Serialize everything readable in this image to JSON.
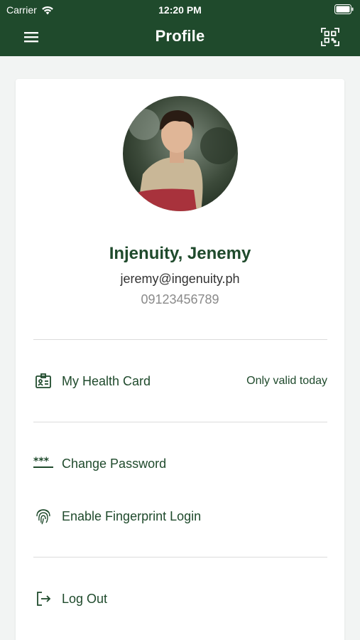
{
  "status_bar": {
    "carrier": "Carrier",
    "time": "12:20 PM"
  },
  "header": {
    "title": "Profile",
    "menu_icon": "hamburger-menu-icon",
    "qr_icon": "qr-scan-icon"
  },
  "profile": {
    "name": "Injenuity, Jenemy",
    "email": "jeremy@ingenuity.ph",
    "phone": "09123456789"
  },
  "menu": {
    "health_card": {
      "label": "My Health Card",
      "meta": "Only valid today",
      "icon": "id-card-icon"
    },
    "change_password": {
      "label": "Change Password",
      "icon": "password-icon"
    },
    "fingerprint": {
      "label": "Enable Fingerprint Login",
      "icon": "fingerprint-icon"
    },
    "logout": {
      "label": "Log Out",
      "icon": "logout-icon"
    }
  },
  "colors": {
    "primary": "#1f4a2c",
    "background": "#f2f4f3",
    "card": "#ffffff"
  }
}
